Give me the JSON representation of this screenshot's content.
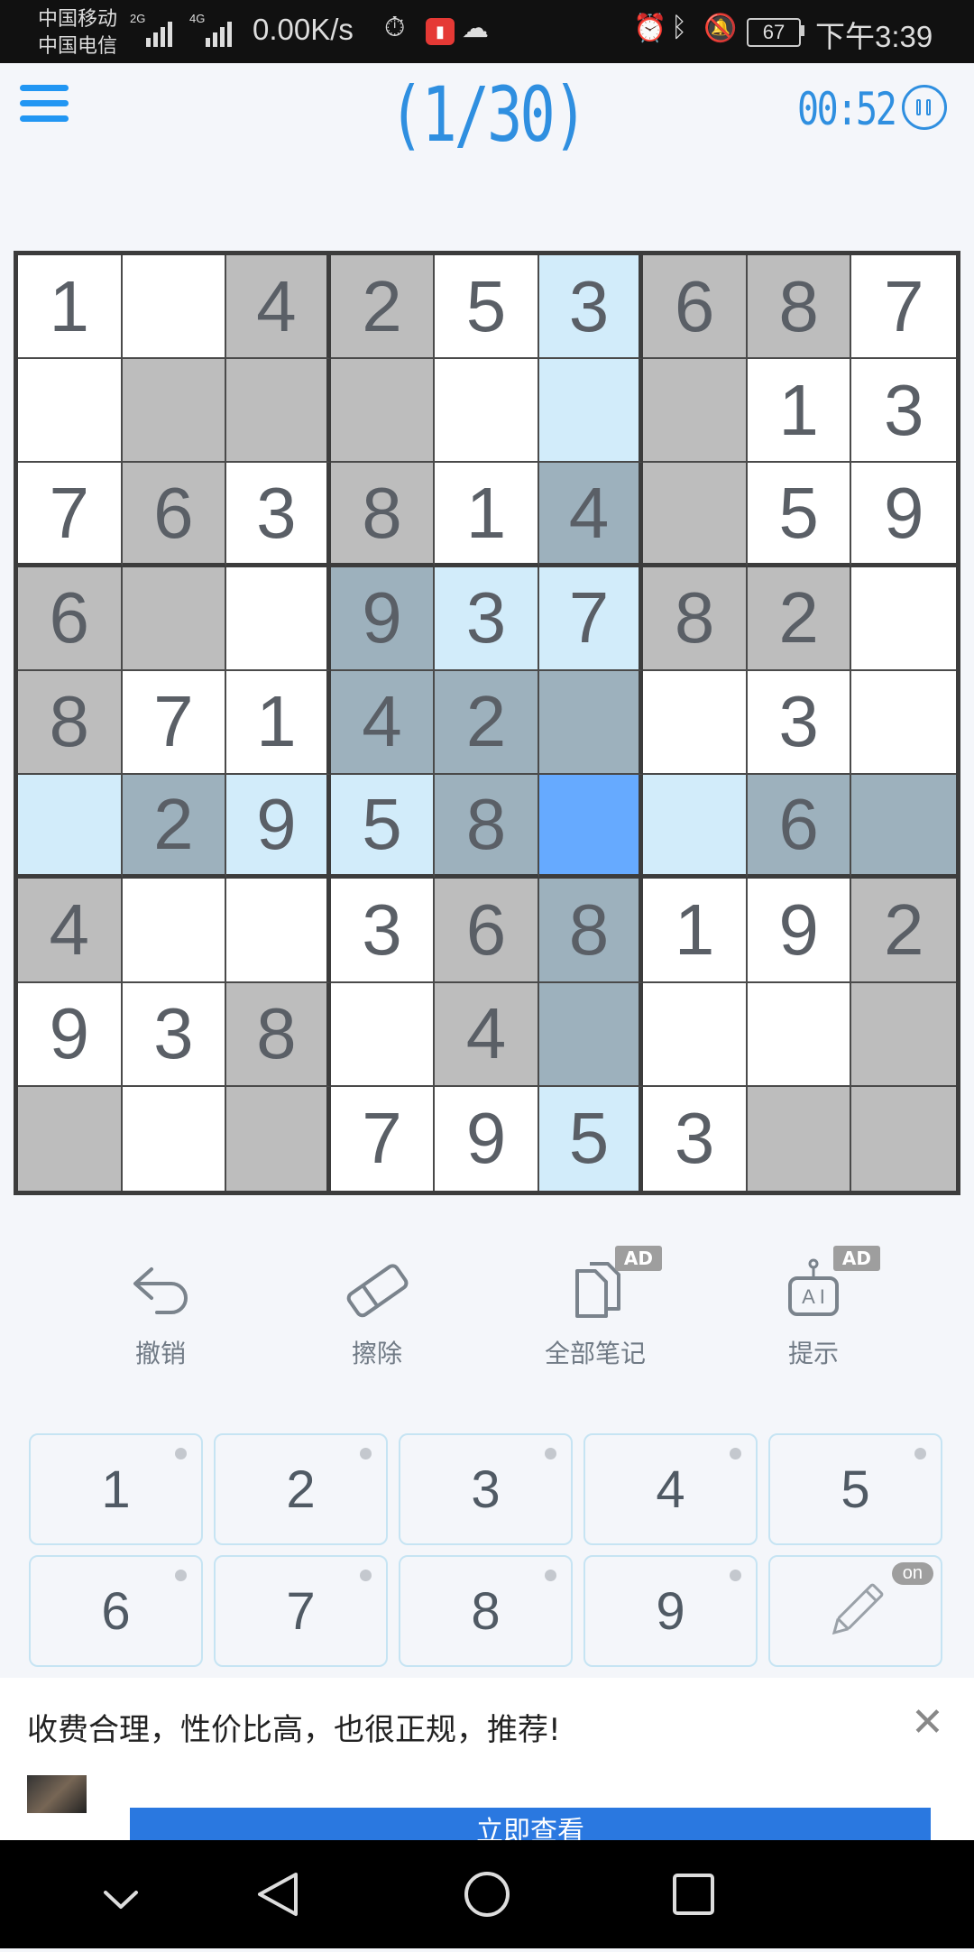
{
  "status_bar": {
    "carrier_1": "中国移动",
    "carrier_2": "中国电信",
    "net_1": "2G",
    "net_2": "4G",
    "speed": "0.00K/s",
    "battery": "67",
    "time": "下午3:39"
  },
  "header": {
    "level": "(1/30)",
    "timer": "00:52"
  },
  "board": {
    "values": [
      [
        "1",
        "",
        "4",
        "2",
        "5",
        "3",
        "6",
        "8",
        "7"
      ],
      [
        "",
        "",
        "",
        "",
        "",
        "",
        "",
        "1",
        "3"
      ],
      [
        "7",
        "6",
        "3",
        "8",
        "1",
        "4",
        "",
        "5",
        "9"
      ],
      [
        "6",
        "",
        "",
        "9",
        "3",
        "7",
        "8",
        "2",
        ""
      ],
      [
        "8",
        "7",
        "1",
        "4",
        "2",
        "",
        "",
        "3",
        ""
      ],
      [
        "",
        "2",
        "9",
        "5",
        "8",
        "",
        "",
        "6",
        ""
      ],
      [
        "4",
        "",
        "",
        "3",
        "6",
        "8",
        "1",
        "9",
        "2"
      ],
      [
        "9",
        "3",
        "8",
        "",
        "4",
        "",
        "",
        "",
        ""
      ],
      [
        "",
        "",
        "",
        "7",
        "9",
        "5",
        "3",
        "",
        ""
      ]
    ],
    "shading": [
      [
        "w",
        "w",
        "g",
        "g",
        "w",
        "l",
        "g",
        "g",
        "w"
      ],
      [
        "w",
        "g",
        "g",
        "g",
        "w",
        "l",
        "g",
        "w",
        "w"
      ],
      [
        "w",
        "g",
        "w",
        "g",
        "w",
        "s",
        "g",
        "w",
        "w"
      ],
      [
        "g",
        "g",
        "w",
        "s",
        "l",
        "l",
        "g",
        "g",
        "w"
      ],
      [
        "g",
        "w",
        "w",
        "s",
        "s",
        "s",
        "w",
        "w",
        "w"
      ],
      [
        "l",
        "s",
        "l",
        "l",
        "s",
        "b",
        "l",
        "s",
        "s"
      ],
      [
        "g",
        "w",
        "w",
        "w",
        "g",
        "s",
        "w",
        "w",
        "g"
      ],
      [
        "w",
        "w",
        "g",
        "w",
        "g",
        "s",
        "w",
        "w",
        "g"
      ],
      [
        "g",
        "w",
        "g",
        "w",
        "w",
        "l",
        "w",
        "g",
        "g"
      ]
    ],
    "shade_colors": {
      "w": "#ffffff",
      "g": "#bdbdbd",
      "l": "#d2ecfa",
      "s": "#9db1bd",
      "b": "#66aaff"
    }
  },
  "toolbar": {
    "undo": "撤销",
    "erase": "擦除",
    "notes": "全部笔记",
    "hint": "提示",
    "ad_badge": "AD"
  },
  "keypad": {
    "keys": [
      "1",
      "2",
      "3",
      "4",
      "5",
      "6",
      "7",
      "8",
      "9"
    ],
    "pencil_badge": "on"
  },
  "ad": {
    "text": "收费合理，性价比高，也很正规，推荐!",
    "cta": "立即查看"
  }
}
